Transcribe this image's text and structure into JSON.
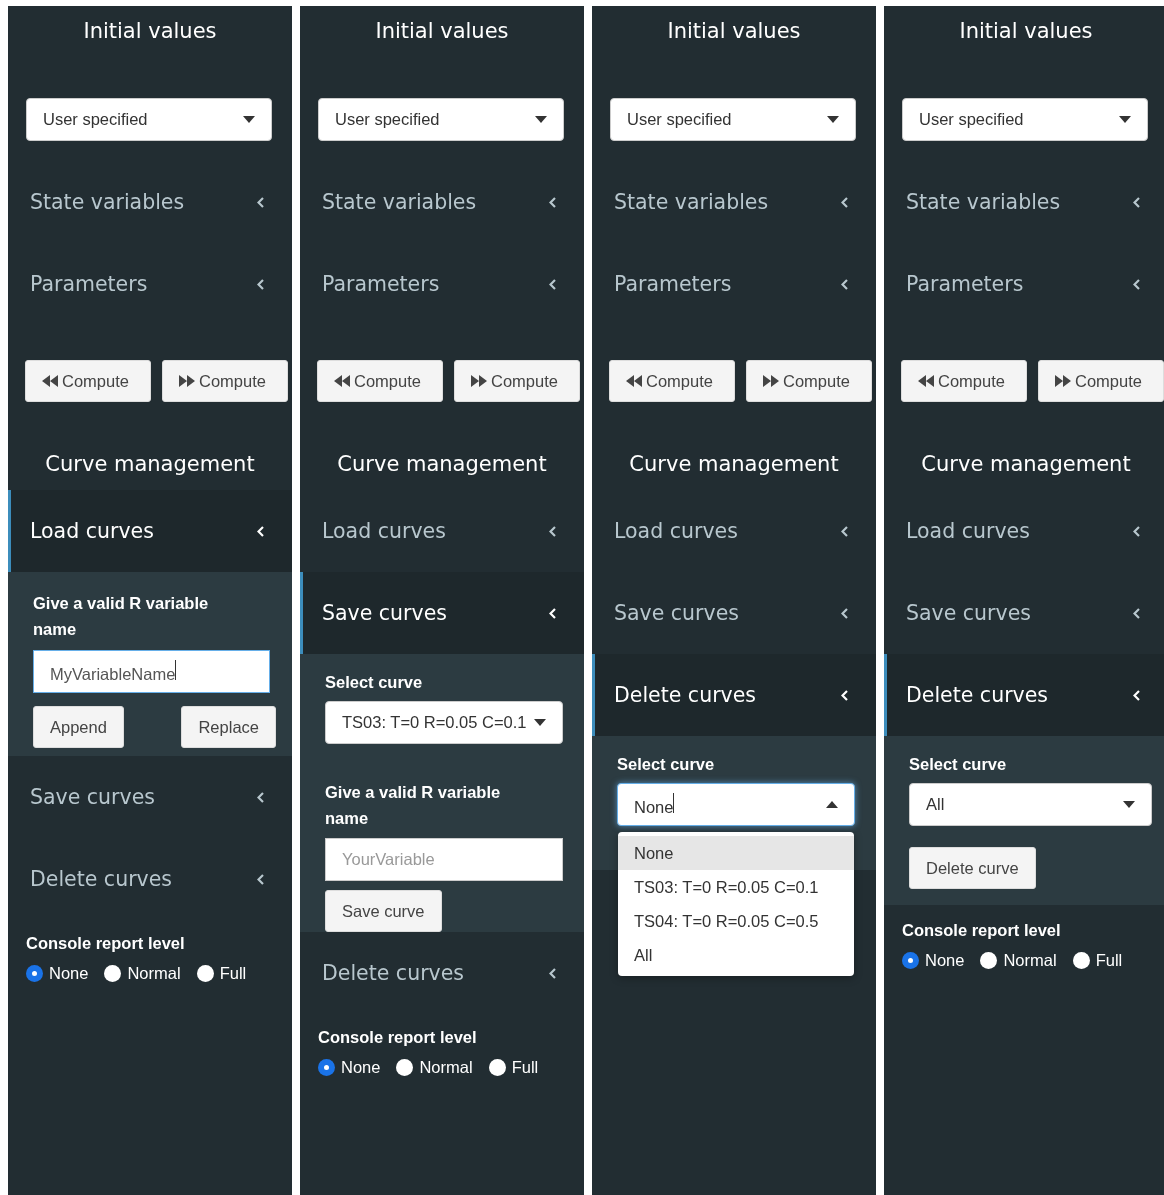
{
  "panels": [
    {
      "initial_values": {
        "title": "Initial values",
        "select": "User specified"
      },
      "menus": [
        {
          "label": "State variables"
        },
        {
          "label": "Parameters"
        }
      ],
      "compute_buttons": [
        {
          "label": "Compute",
          "kind": "backward"
        },
        {
          "label": "Compute",
          "kind": "forward"
        }
      ],
      "curve_management": {
        "title": "Curve management",
        "items": [
          {
            "label": "Load curves",
            "kind": "load",
            "expanded": true,
            "content": {
              "label": "Give a valid R variable name",
              "value": "MyVariableName",
              "focused": true,
              "buttons": [
                "Append",
                "Replace"
              ]
            }
          },
          {
            "label": "Save curves",
            "expanded": false
          },
          {
            "label": "Delete curves",
            "expanded": false
          }
        ]
      },
      "console": {
        "title": "Console report level",
        "options": [
          {
            "label": "None",
            "selected": true
          },
          {
            "label": "Normal",
            "selected": false
          },
          {
            "label": "Full",
            "selected": false
          }
        ]
      }
    },
    {
      "initial_values": {
        "title": "Initial values",
        "select": "User specified"
      },
      "menus": [
        {
          "label": "State variables"
        },
        {
          "label": "Parameters"
        }
      ],
      "compute_buttons": [
        {
          "label": "Compute",
          "kind": "backward"
        },
        {
          "label": "Compute",
          "kind": "forward"
        }
      ],
      "curve_management": {
        "title": "Curve management",
        "items": [
          {
            "label": "Load curves",
            "expanded": false
          },
          {
            "label": "Save curves",
            "kind": "save",
            "expanded": true,
            "content": {
              "select_label": "Select curve",
              "select_value": "TS03: T=0 R=0.05 C=0.1",
              "label": "Give a valid R variable name",
              "placeholder": "YourVariable",
              "button": "Save curve"
            }
          },
          {
            "label": "Delete curves",
            "expanded": false
          }
        ]
      },
      "console": {
        "title": "Console report level",
        "options": [
          {
            "label": "None",
            "selected": true
          },
          {
            "label": "Normal",
            "selected": false
          },
          {
            "label": "Full",
            "selected": false
          }
        ]
      }
    },
    {
      "initial_values": {
        "title": "Initial values",
        "select": "User specified"
      },
      "menus": [
        {
          "label": "State variables"
        },
        {
          "label": "Parameters"
        }
      ],
      "compute_buttons": [
        {
          "label": "Compute",
          "kind": "backward"
        },
        {
          "label": "Compute",
          "kind": "forward"
        }
      ],
      "curve_management": {
        "title": "Curve management",
        "items": [
          {
            "label": "Load curves",
            "expanded": false
          },
          {
            "label": "Save curves",
            "expanded": false
          },
          {
            "label": "Delete curves",
            "kind": "delete",
            "expanded": true,
            "content": {
              "select_label": "Select curve",
              "select_value": "None",
              "focused": true,
              "open": true,
              "options": [
                {
                  "label": "None",
                  "selected": true
                },
                {
                  "label": "TS03: T=0 R=0.05 C=0.1",
                  "selected": false
                },
                {
                  "label": "TS04: T=0 R=0.05 C=0.5",
                  "selected": false
                },
                {
                  "label": "All",
                  "selected": false
                }
              ]
            }
          }
        ]
      }
    },
    {
      "initial_values": {
        "title": "Initial values",
        "select": "User specified"
      },
      "menus": [
        {
          "label": "State variables"
        },
        {
          "label": "Parameters"
        }
      ],
      "compute_buttons": [
        {
          "label": "Compute",
          "kind": "backward"
        },
        {
          "label": "Compute",
          "kind": "forward"
        }
      ],
      "curve_management": {
        "title": "Curve management",
        "items": [
          {
            "label": "Load curves",
            "expanded": false
          },
          {
            "label": "Save curves",
            "expanded": false
          },
          {
            "label": "Delete curves",
            "kind": "delete",
            "expanded": true,
            "content": {
              "select_label": "Select curve",
              "select_value": "All",
              "focused": false,
              "open": false,
              "button": "Delete curve"
            }
          }
        ]
      },
      "console": {
        "title": "Console report level",
        "options": [
          {
            "label": "None",
            "selected": true
          },
          {
            "label": "Normal",
            "selected": false
          },
          {
            "label": "Full",
            "selected": false
          }
        ]
      }
    }
  ]
}
